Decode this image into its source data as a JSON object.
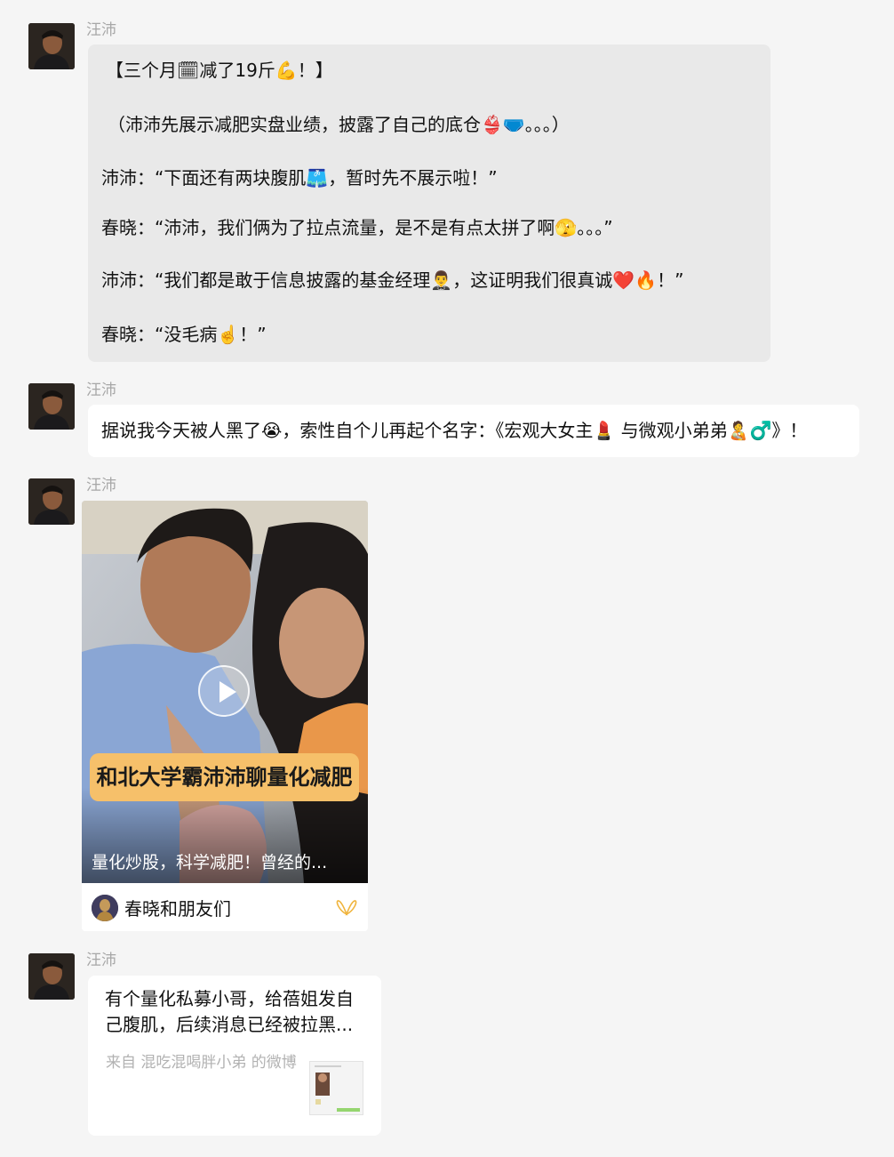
{
  "messages": [
    {
      "sender": "汪沛",
      "lines": [
        "【三个月🗓减了19斤💪！】",
        "（沛沛先展示减肥实盘业绩，披露了自己的底仓👙🩲。。。）",
        "沛沛：“下面还有两块腹肌🩳，暂时先不展示啦！”",
        "春晓：“沛沛，我们俩为了拉点流量，是不是有点太拼了啊🫣。。。”",
        "沛沛：“我们都是敢于信息披露的基金经理🤵‍♂️，这证明我们很真诚❤️🔥！”",
        "春晓：“没毛病☝️！”"
      ]
    },
    {
      "sender": "汪沛",
      "text": "据说我今天被人黑了😭，索性自个儿再起个名字：《宏观大女主💄 与微观小弟弟🧑‍🍼♂️》！"
    },
    {
      "sender": "汪沛",
      "video": {
        "banner": "和北大学霸沛沛聊量化减肥",
        "caption": "量化炒股，科学减肥！曾经的...",
        "channel_name": "春晓和朋友们",
        "channel_icon": "channels-butterfly-icon",
        "accent": "#f6c06a"
      }
    },
    {
      "sender": "汪沛",
      "link": {
        "title": "有个量化私募小哥，给蓓姐发自己腹肌，后续消息已经被拉黑...",
        "source": "来自 混吃混喝胖小弟 的微博"
      }
    }
  ],
  "colors": {
    "background": "#f5f5f5",
    "bubble_grey": "#e9e9e9",
    "bubble_white": "#ffffff",
    "sender_name": "#a7a7a7"
  }
}
